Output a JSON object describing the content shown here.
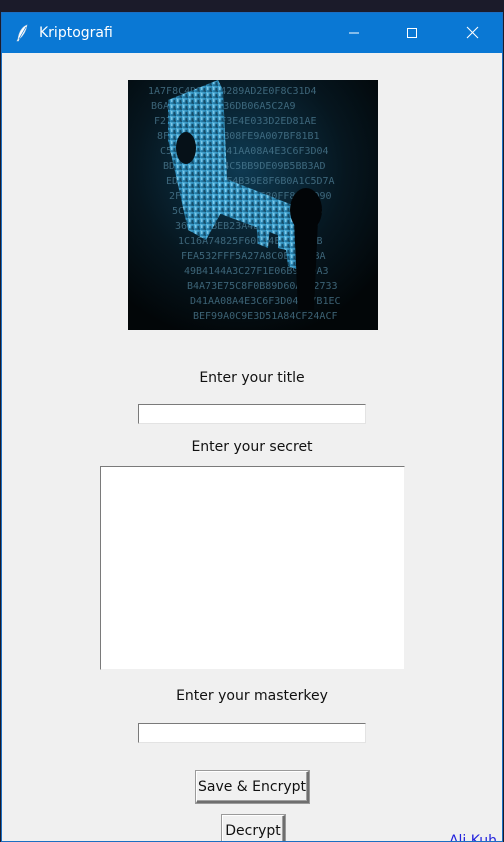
{
  "window": {
    "title": "Kriptografi",
    "app_icon": "feather-icon",
    "controls": [
      "minimize-icon",
      "maximize-icon",
      "close-icon"
    ]
  },
  "hero": {
    "image": "key-with-binary-code-image",
    "cipher_lines": [
      "1A7F8C4D1BE34289AD2E0F8C31D4",
      "B6AA4C3FC64F36DB06A5C2A9",
      "F27BE10085CF3E4E033D2ED81AE",
      "8F17D9B2C58B08FE9A007BF81B1",
      "C5B88A1E00D41AA08A4E3C6F3D04",
      "BD97B1EC6F4C5BB9DE09B5BB3AD",
      "ED2D5B4CC1F4B39E8F6B0A1C5D7A",
      "2F1E55C7551A9A4C80FF81EBD90",
      "5C8B2FF8C0B4A14E47C16A748",
      "360925BEB23A4E6F50F0B1C7",
      "1C16A74825F60EF4E4B04CCB",
      "FEA532FFF5A27A8C0E32A4BA",
      "49B4144A3C27F1E06B9B5DA3",
      "B4A73E75C8F0B89D60A4C2733",
      "D41AA08A4E3C6F3D04B97B1EC",
      "BEF99A0C9E3D51A84CF24ACF"
    ]
  },
  "form": {
    "title_label": "Enter your title",
    "title_value": "",
    "secret_label": "Enter your secret",
    "secret_value": "",
    "masterkey_label": "Enter your masterkey",
    "masterkey_value": ""
  },
  "buttons": {
    "save_encrypt_label": "Save & Encrypt",
    "decrypt_label": "Decrypt"
  },
  "footer": {
    "credit": "Ali Kuh"
  },
  "colors": {
    "titlebar": "#0a78d4",
    "window_bg": "#f0f0f0",
    "credit_text": "#2222dd"
  }
}
